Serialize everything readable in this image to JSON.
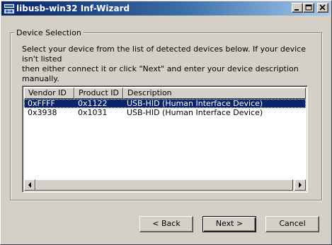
{
  "window": {
    "title": "libusb-win32 Inf-Wizard"
  },
  "group": {
    "label": "Device Selection",
    "instructions": "Select your device from the list of detected devices below. If your device isn't listed\nthen either connect it or click \"Next\" and enter your device description manually."
  },
  "device_list": {
    "columns": [
      "Vendor ID",
      "Product ID",
      "Description"
    ],
    "rows": [
      {
        "vendor": "0xFFFF",
        "product": "0x1122",
        "description": "USB-HID (Human Interface Device)",
        "selected": true
      },
      {
        "vendor": "0x3938",
        "product": "0x1031",
        "description": "USB-HID (Human Interface Device)",
        "selected": false
      }
    ]
  },
  "buttons": {
    "back": "< Back",
    "next": "Next >",
    "cancel": "Cancel"
  },
  "colors": {
    "titlebar_start": "#0a246a",
    "titlebar_end": "#a6caf0",
    "face": "#d4d0c8",
    "selection": "#0a246a"
  }
}
